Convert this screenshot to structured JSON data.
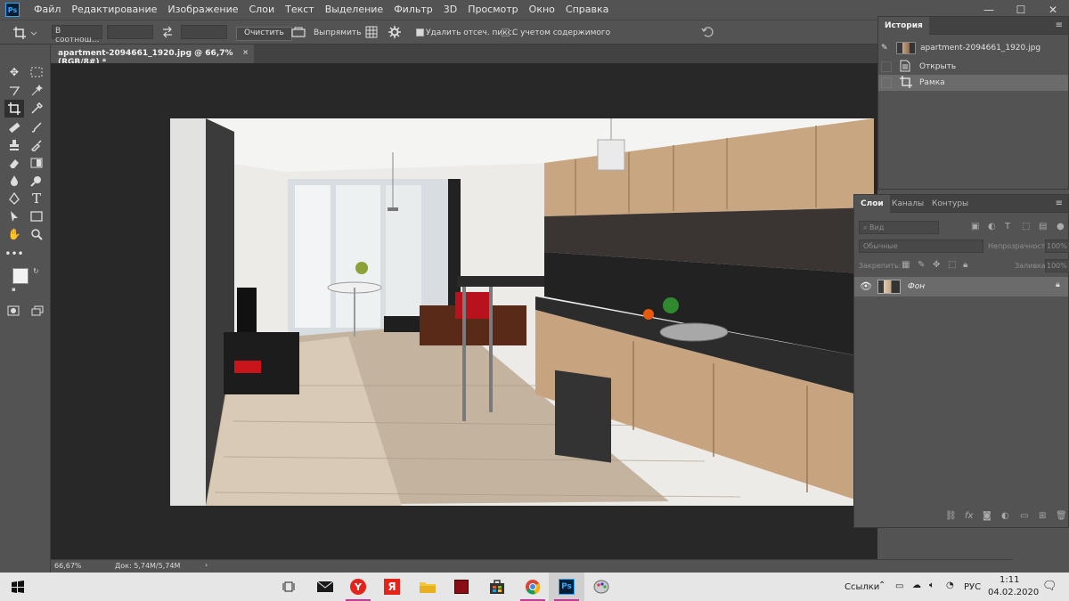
{
  "menubar": {
    "logo": "Ps",
    "items": [
      "Файл",
      "Редактирование",
      "Изображение",
      "Слои",
      "Текст",
      "Выделение",
      "Фильтр",
      "3D",
      "Просмотр",
      "Окно",
      "Справка"
    ],
    "window_controls": [
      "—",
      "☐",
      "✕"
    ]
  },
  "optionsbar": {
    "ratio_select": "В соотнош...",
    "clear_button": "Очистить",
    "straighten_label": "Выпрямить",
    "delete_cropped_label": "Удалить отсеч. пикс.",
    "delete_cropped_checked": true,
    "content_aware_label": "С учетом содержимого",
    "content_aware_checked": false
  },
  "document": {
    "tab_title": "apartment-2094661_1920.jpg @ 66,7% (RGB/8#) *",
    "close": "×"
  },
  "statusbar": {
    "zoom": "66,67%",
    "doc_size": "Док: 5,74M/5,74M",
    "arrow": "›"
  },
  "history_panel": {
    "tab": "История",
    "snapshot_name": "apartment-2094661_1920.jpg",
    "states": [
      {
        "name": "Открыть",
        "icon": "document-icon",
        "selected": false
      },
      {
        "name": "Рамка",
        "icon": "crop-icon",
        "selected": true
      }
    ]
  },
  "layers_panel": {
    "tabs": [
      "Слои",
      "Каналы",
      "Контуры"
    ],
    "filter_placeholder": "Вид",
    "blend_mode": "Обычные",
    "opacity_label": "Непрозрачность:",
    "opacity_value": "100%",
    "lock_label": "Закрепить:",
    "fill_label": "Заливка:",
    "fill_value": "100%",
    "layers": [
      {
        "name": "Фон",
        "visible": true,
        "locked": true
      }
    ]
  },
  "taskbar": {
    "tray_links": "Ссылки",
    "language": "РУС",
    "time": "1:11",
    "date": "04.02.2020"
  },
  "colors": {
    "ps_blue": "#31a8ff",
    "taskbar_indicator": "#c43a99",
    "ui_gray": "#535353"
  }
}
